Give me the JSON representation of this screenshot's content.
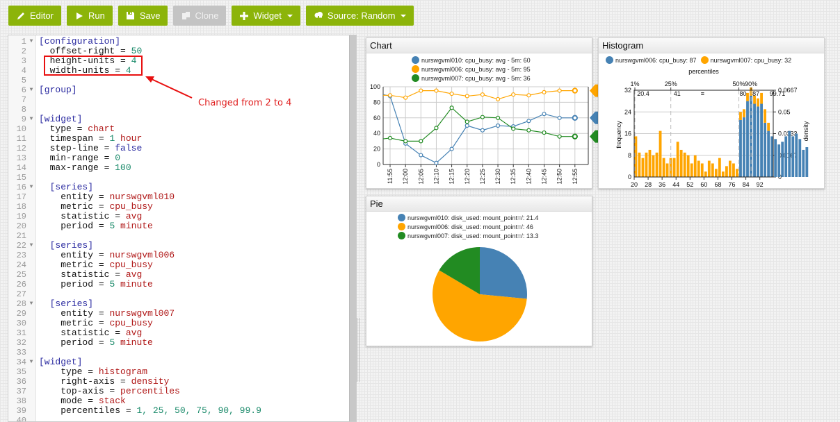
{
  "toolbar": {
    "buttons": [
      {
        "label": "Editor",
        "icon": "pencil-icon",
        "enabled": true
      },
      {
        "label": "Run",
        "icon": "play-icon",
        "enabled": true
      },
      {
        "label": "Save",
        "icon": "floppy-icon",
        "enabled": true
      },
      {
        "label": "Clone",
        "icon": "copy-icon",
        "enabled": false
      },
      {
        "label": "Widget",
        "icon": "plus-icon",
        "enabled": true,
        "dropdown": true
      },
      {
        "label": "Source: Random",
        "icon": "cloud-download-icon",
        "enabled": true,
        "dropdown": true
      }
    ]
  },
  "editor": {
    "lines": [
      {
        "n": "1",
        "fold": true,
        "indent": "",
        "parts": [
          [
            "sec",
            "[configuration]"
          ]
        ]
      },
      {
        "n": "2",
        "indent": "  ",
        "parts": [
          [
            "",
            "offset-right = "
          ],
          [
            "num",
            "50"
          ]
        ]
      },
      {
        "n": "3",
        "indent": "  ",
        "parts": [
          [
            "",
            "height-units = "
          ],
          [
            "num",
            "4"
          ]
        ]
      },
      {
        "n": "4",
        "indent": "  ",
        "parts": [
          [
            "",
            "width-units = "
          ],
          [
            "num",
            "4"
          ]
        ]
      },
      {
        "n": "5",
        "indent": "",
        "parts": []
      },
      {
        "n": "6",
        "fold": true,
        "indent": "",
        "parts": [
          [
            "sec",
            "[group]"
          ]
        ]
      },
      {
        "n": "7",
        "indent": "",
        "parts": []
      },
      {
        "n": "8",
        "indent": "",
        "parts": []
      },
      {
        "n": "9",
        "fold": true,
        "indent": "",
        "parts": [
          [
            "sec",
            "[widget]"
          ]
        ]
      },
      {
        "n": "10",
        "indent": "  ",
        "parts": [
          [
            "",
            "type = "
          ],
          [
            "str",
            "chart"
          ]
        ]
      },
      {
        "n": "11",
        "indent": "  ",
        "parts": [
          [
            "",
            "timespan = "
          ],
          [
            "num",
            "1"
          ],
          [
            "str",
            " hour"
          ]
        ]
      },
      {
        "n": "12",
        "indent": "  ",
        "parts": [
          [
            "",
            "step-line = "
          ],
          [
            "bool",
            "false"
          ]
        ]
      },
      {
        "n": "13",
        "indent": "  ",
        "parts": [
          [
            "",
            "min-range = "
          ],
          [
            "num",
            "0"
          ]
        ]
      },
      {
        "n": "14",
        "indent": "  ",
        "parts": [
          [
            "",
            "max-range = "
          ],
          [
            "num",
            "100"
          ]
        ]
      },
      {
        "n": "15",
        "indent": "",
        "parts": []
      },
      {
        "n": "16",
        "fold": true,
        "indent": "  ",
        "parts": [
          [
            "sec",
            "[series]"
          ]
        ]
      },
      {
        "n": "17",
        "indent": "    ",
        "parts": [
          [
            "",
            "entity = "
          ],
          [
            "str",
            "nurswgvml010"
          ]
        ]
      },
      {
        "n": "18",
        "indent": "    ",
        "parts": [
          [
            "",
            "metric = "
          ],
          [
            "str",
            "cpu_busy"
          ]
        ]
      },
      {
        "n": "19",
        "indent": "    ",
        "parts": [
          [
            "",
            "statistic = "
          ],
          [
            "str",
            "avg"
          ]
        ]
      },
      {
        "n": "20",
        "indent": "    ",
        "parts": [
          [
            "",
            "period = "
          ],
          [
            "num",
            "5"
          ],
          [
            "str",
            " minute"
          ]
        ]
      },
      {
        "n": "21",
        "indent": "",
        "parts": []
      },
      {
        "n": "22",
        "fold": true,
        "indent": "  ",
        "parts": [
          [
            "sec",
            "[series]"
          ]
        ]
      },
      {
        "n": "23",
        "indent": "    ",
        "parts": [
          [
            "",
            "entity = "
          ],
          [
            "str",
            "nurswgvml006"
          ]
        ]
      },
      {
        "n": "24",
        "indent": "    ",
        "parts": [
          [
            "",
            "metric = "
          ],
          [
            "str",
            "cpu_busy"
          ]
        ]
      },
      {
        "n": "25",
        "indent": "    ",
        "parts": [
          [
            "",
            "statistic = "
          ],
          [
            "str",
            "avg"
          ]
        ]
      },
      {
        "n": "26",
        "indent": "    ",
        "parts": [
          [
            "",
            "period = "
          ],
          [
            "num",
            "5"
          ],
          [
            "str",
            " minute"
          ]
        ]
      },
      {
        "n": "27",
        "indent": "",
        "parts": []
      },
      {
        "n": "28",
        "fold": true,
        "indent": "  ",
        "parts": [
          [
            "sec",
            "[series]"
          ]
        ]
      },
      {
        "n": "29",
        "indent": "    ",
        "parts": [
          [
            "",
            "entity = "
          ],
          [
            "str",
            "nurswgvml007"
          ]
        ]
      },
      {
        "n": "30",
        "indent": "    ",
        "parts": [
          [
            "",
            "metric = "
          ],
          [
            "str",
            "cpu_busy"
          ]
        ]
      },
      {
        "n": "31",
        "indent": "    ",
        "parts": [
          [
            "",
            "statistic = "
          ],
          [
            "str",
            "avg"
          ]
        ]
      },
      {
        "n": "32",
        "indent": "    ",
        "parts": [
          [
            "",
            "period = "
          ],
          [
            "num",
            "5"
          ],
          [
            "str",
            " minute"
          ]
        ]
      },
      {
        "n": "33",
        "indent": "",
        "parts": []
      },
      {
        "n": "34",
        "fold": true,
        "indent": "",
        "parts": [
          [
            "sec",
            "[widget]"
          ]
        ]
      },
      {
        "n": "35",
        "indent": "    ",
        "parts": [
          [
            "",
            "type = "
          ],
          [
            "str",
            "histogram"
          ]
        ]
      },
      {
        "n": "36",
        "indent": "    ",
        "parts": [
          [
            "",
            "right-axis = "
          ],
          [
            "str",
            "density"
          ]
        ]
      },
      {
        "n": "37",
        "indent": "    ",
        "parts": [
          [
            "",
            "top-axis = "
          ],
          [
            "str",
            "percentiles"
          ]
        ]
      },
      {
        "n": "38",
        "indent": "    ",
        "parts": [
          [
            "",
            "mode = "
          ],
          [
            "str",
            "stack"
          ]
        ]
      },
      {
        "n": "39",
        "indent": "    ",
        "parts": [
          [
            "",
            "percentiles = "
          ],
          [
            "num",
            "1, 25, 50, 75, 90, 99.9"
          ]
        ]
      },
      {
        "n": "40",
        "indent": "",
        "parts": []
      }
    ]
  },
  "annotation": {
    "text": "Changed from 2 to 4",
    "color": "#e81010"
  },
  "colors": {
    "blue": "#4682b4",
    "orange": "#ffa500",
    "green": "#228b22"
  },
  "widgets": {
    "chart": {
      "title": "Chart"
    },
    "histogram": {
      "title": "Histogram"
    },
    "pie": {
      "title": "Pie"
    }
  },
  "chart_data": [
    {
      "type": "line",
      "title": "Chart",
      "x": [
        "11:55",
        "12:00",
        "12:05",
        "12:10",
        "12:15",
        "12:20",
        "12:25",
        "12:30",
        "12:35",
        "12:40",
        "12:45",
        "12:50",
        "12:55"
      ],
      "ylim": [
        0,
        100
      ],
      "yticks": [
        0,
        20,
        40,
        60,
        80,
        100
      ],
      "grid": true,
      "legend": "top-center",
      "series": [
        {
          "name": "nurswgvml010: cpu_busy: avg - 5m: 60",
          "color": "#4682b4",
          "start": 90,
          "values": [
            88,
            27,
            12,
            2,
            20,
            50,
            44,
            50,
            49,
            56,
            65,
            60,
            60
          ],
          "badge": "60"
        },
        {
          "name": "nurswgvml006: cpu_busy: avg - 5m: 95",
          "color": "#ffa500",
          "start": 89,
          "values": [
            89,
            86,
            95,
            95,
            91,
            88,
            90,
            84,
            90,
            89,
            93,
            95,
            95
          ],
          "badge": "95"
        },
        {
          "name": "nurswgvml007: cpu_busy: avg - 5m: 36",
          "color": "#228b22",
          "start": 33,
          "values": [
            34,
            30,
            30,
            47,
            73,
            55,
            61,
            60,
            46,
            44,
            41,
            36,
            36
          ],
          "badge": "36"
        }
      ]
    },
    {
      "type": "bar",
      "title": "Histogram",
      "mode": "stack",
      "xlabel": "",
      "ylabel": "frequency",
      "y2label": "density",
      "toplabel": "percentiles",
      "xlim": [
        20,
        99.7
      ],
      "xticks": [
        20,
        28,
        36,
        44,
        52,
        60,
        68,
        76,
        84,
        92
      ],
      "ylim": [
        0,
        32
      ],
      "yticks": [
        0,
        8,
        16,
        24,
        32
      ],
      "y2ticks": [
        "0",
        "0.0167",
        "0.0333",
        "0.05",
        "0.0667"
      ],
      "percentile_ticks": [
        {
          "label": "1%",
          "value": 20.4
        },
        {
          "label": "25%",
          "value": 41
        },
        {
          "label": "50%",
          "value": 80
        },
        {
          "label": "90%",
          "value": 87
        }
      ],
      "percentile_values": [
        "20.4",
        "41",
        "≡",
        "80",
        "87",
        "99.71"
      ],
      "legend": "top",
      "series": [
        {
          "name": "nurswgvml006: cpu_busy: 87",
          "color": "#4682b4",
          "values": [
            0,
            0,
            0,
            0,
            0,
            0,
            0,
            0,
            0,
            0,
            0,
            0,
            0,
            0,
            0,
            0,
            0,
            0,
            0,
            0,
            0,
            0,
            0,
            0,
            0,
            0,
            0,
            0,
            0,
            0,
            0,
            0,
            0,
            0,
            0,
            0,
            0,
            0,
            0,
            0,
            0,
            0,
            0,
            0,
            0,
            0,
            0,
            0,
            0,
            0,
            0,
            0,
            0,
            0,
            0,
            0,
            0,
            0,
            0,
            0,
            0,
            0,
            0,
            0,
            0,
            0,
            0,
            0,
            0,
            0,
            0,
            0,
            0,
            0,
            0,
            0,
            0,
            0,
            0,
            0,
            0,
            0,
            0,
            0,
            0,
            0,
            0,
            0,
            0,
            0,
            0,
            0,
            0,
            0,
            0,
            0,
            0,
            0,
            0,
            0,
            0,
            0,
            0,
            0,
            0,
            0,
            0,
            0,
            0,
            0,
            0,
            0,
            0,
            0,
            0,
            0,
            0,
            0,
            0,
            0,
            0,
            0,
            0,
            0,
            0,
            0,
            0,
            0,
            0,
            0,
            0,
            0,
            0,
            0,
            0,
            0,
            0,
            0,
            0,
            0,
            0,
            0,
            0,
            0,
            0,
            0,
            0,
            0,
            0,
            0,
            0,
            0,
            0,
            0,
            0,
            0,
            0,
            0,
            0,
            0,
            0,
            0,
            0,
            0,
            0,
            0,
            0,
            0,
            0,
            0,
            0,
            0,
            0,
            0,
            0,
            0,
            0,
            0,
            0,
            0,
            0,
            0,
            0,
            0,
            0,
            0,
            0,
            0,
            0,
            0,
            0,
            0,
            0,
            0,
            0,
            0,
            0,
            0,
            0,
            0
          ]
        },
        {
          "name": "nurswgvml007: cpu_busy: 32",
          "color": "#ffa500"
        }
      ],
      "bins_start": 20,
      "bin_width": 2,
      "blue_counts": [
        0,
        0,
        0,
        0,
        0,
        0,
        0,
        0,
        0,
        0,
        0,
        0,
        0,
        0,
        0,
        0,
        0,
        0,
        0,
        0,
        0,
        0,
        0,
        0,
        0,
        0,
        0,
        0,
        0,
        0,
        21,
        22,
        28,
        30,
        27,
        26,
        27,
        20,
        17,
        15,
        14,
        12,
        13,
        15,
        17,
        15,
        16,
        14,
        10,
        11
      ],
      "orange_counts": [
        15,
        9,
        7,
        9,
        10,
        8,
        9,
        17,
        7,
        5,
        7,
        7,
        13,
        10,
        9,
        8,
        5,
        8,
        6,
        5,
        2,
        6,
        5,
        3,
        7,
        2,
        4,
        6,
        5,
        3,
        3,
        3,
        3,
        3,
        3,
        3,
        4,
        5,
        3,
        0,
        0,
        0,
        0,
        0,
        0,
        0,
        0,
        0,
        0,
        0
      ]
    },
    {
      "type": "pie",
      "title": "Pie",
      "legend": "top-center",
      "series": [
        {
          "name": "nurswgvml010: disk_used: mount_point=/: 21.4",
          "value": 21.4,
          "color": "#4682b4"
        },
        {
          "name": "nurswgvml006: disk_used: mount_point=/: 46",
          "value": 46,
          "color": "#ffa500"
        },
        {
          "name": "nurswgvml007: disk_used: mount_point=/: 13.3",
          "value": 13.3,
          "color": "#228b22"
        }
      ]
    }
  ]
}
